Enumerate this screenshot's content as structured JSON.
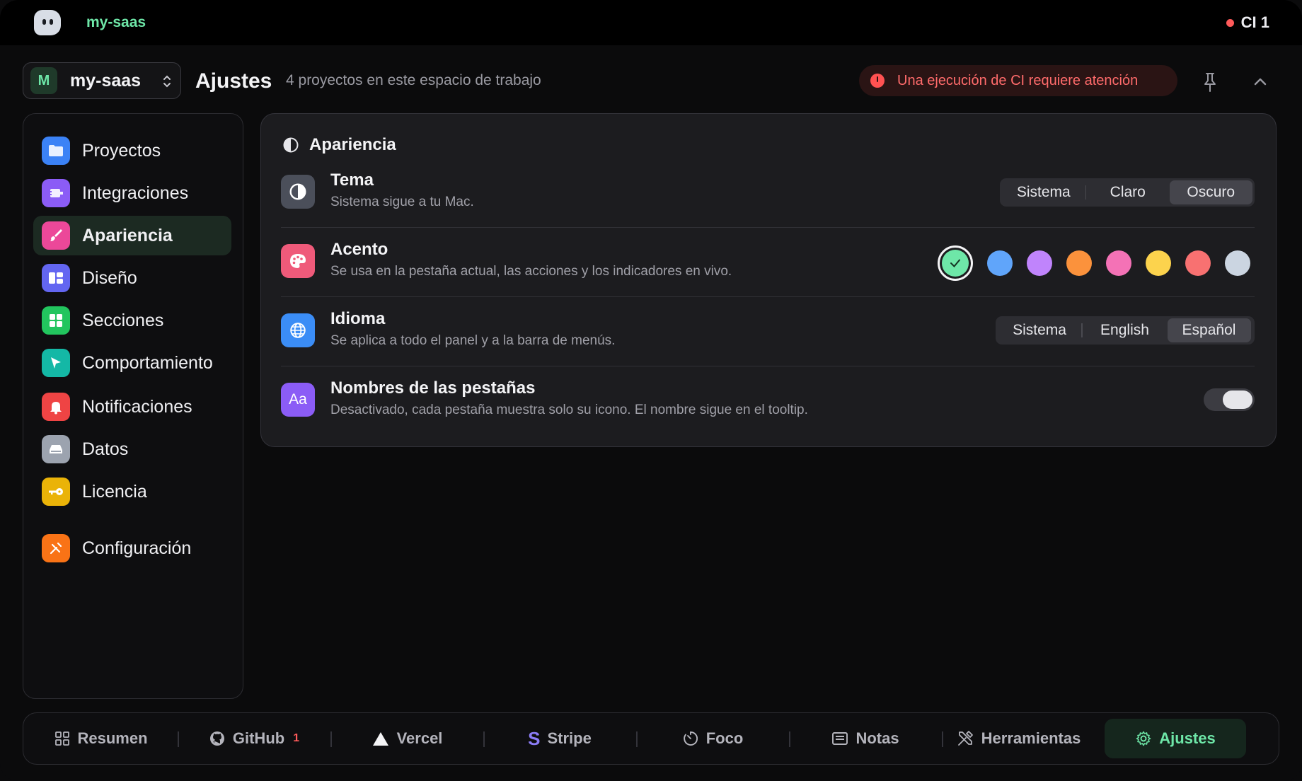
{
  "menubar": {
    "project": "my-saas",
    "ci_label": "CI 1",
    "ci_dot_color": "#ff5a5a"
  },
  "header": {
    "workspace_initial": "M",
    "workspace_name": "my-saas",
    "title": "Ajustes",
    "subtitle": "4 proyectos en este espacio de trabajo",
    "alert_text": "Una ejecución de CI requiere atención"
  },
  "sidebar": {
    "items": [
      {
        "label": "Proyectos",
        "icon": "folder-icon",
        "color": "#3b82f6"
      },
      {
        "label": "Integraciones",
        "icon": "plug-icon",
        "color": "#8b5cf6"
      },
      {
        "label": "Apariencia",
        "icon": "paintbrush-icon",
        "color": "#ec4899",
        "active": true
      },
      {
        "label": "Diseño",
        "icon": "layout-icon",
        "color": "#6366f1"
      },
      {
        "label": "Secciones",
        "icon": "grid-icon",
        "color": "#22c55e"
      },
      {
        "label": "Comportamiento",
        "icon": "cursor-icon",
        "color": "#14b8a6"
      },
      {
        "label": "Notificaciones",
        "icon": "bell-icon",
        "color": "#ef4444"
      },
      {
        "label": "Datos",
        "icon": "drive-icon",
        "color": "#9ca3af"
      },
      {
        "label": "Licencia",
        "icon": "key-icon",
        "color": "#eab308"
      },
      {
        "label": "Configuración",
        "icon": "tools-icon",
        "color": "#f97316"
      }
    ]
  },
  "appearance": {
    "title": "Apariencia",
    "theme": {
      "title": "Tema",
      "desc": "Sistema sigue a tu Mac.",
      "options": [
        "Sistema",
        "Claro",
        "Oscuro"
      ],
      "selected": "Oscuro"
    },
    "accent": {
      "title": "Acento",
      "desc": "Se usa en la pestaña actual, las acciones y los indicadores en vivo.",
      "colors": [
        "#6ee7a8",
        "#60a5fa",
        "#c084fc",
        "#fb923c",
        "#f472b6",
        "#fcd34d",
        "#f87171",
        "#cbd5e1"
      ],
      "selected_index": 0
    },
    "language": {
      "title": "Idioma",
      "desc": "Se aplica a todo el panel y a la barra de menús.",
      "options": [
        "Sistema",
        "English",
        "Español"
      ],
      "selected": "Español"
    },
    "tab_names": {
      "title": "Nombres de las pestañas",
      "desc": "Desactivado, cada pestaña muestra solo su icono. El nombre sigue en el tooltip.",
      "enabled": false
    }
  },
  "tabbar": {
    "tabs": [
      {
        "label": "Resumen",
        "icon": "grid-icon"
      },
      {
        "label": "GitHub",
        "icon": "github-icon",
        "badge": "1"
      },
      {
        "label": "Vercel",
        "icon": "triangle-icon"
      },
      {
        "label": "Stripe",
        "icon": "stripe-icon"
      },
      {
        "label": "Foco",
        "icon": "timer-icon"
      },
      {
        "label": "Notas",
        "icon": "notes-icon"
      },
      {
        "label": "Herramientas",
        "icon": "tools-icon"
      },
      {
        "label": "Ajustes",
        "icon": "gear-icon",
        "active": true
      }
    ]
  }
}
